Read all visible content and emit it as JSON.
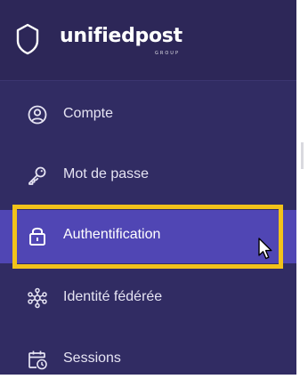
{
  "brand": {
    "name": "unifiedpost",
    "subtitle": "GROUP",
    "logo_icon": "shield-outline-icon"
  },
  "sidebar": {
    "items": [
      {
        "label": "Compte",
        "icon": "account-circle-icon",
        "active": false
      },
      {
        "label": "Mot de passe",
        "icon": "key-icon",
        "active": false
      },
      {
        "label": "Authentification",
        "icon": "lock-icon",
        "active": true
      },
      {
        "label": "Identité fédérée",
        "icon": "network-hub-icon",
        "active": false
      },
      {
        "label": "Sessions",
        "icon": "calendar-clock-icon",
        "active": false
      }
    ]
  },
  "colors": {
    "sidebar_bg": "#312c63",
    "header_bg": "#2d2758",
    "active_bg": "#5046b4",
    "highlight": "#f2c21a",
    "text": "#ffffff"
  }
}
